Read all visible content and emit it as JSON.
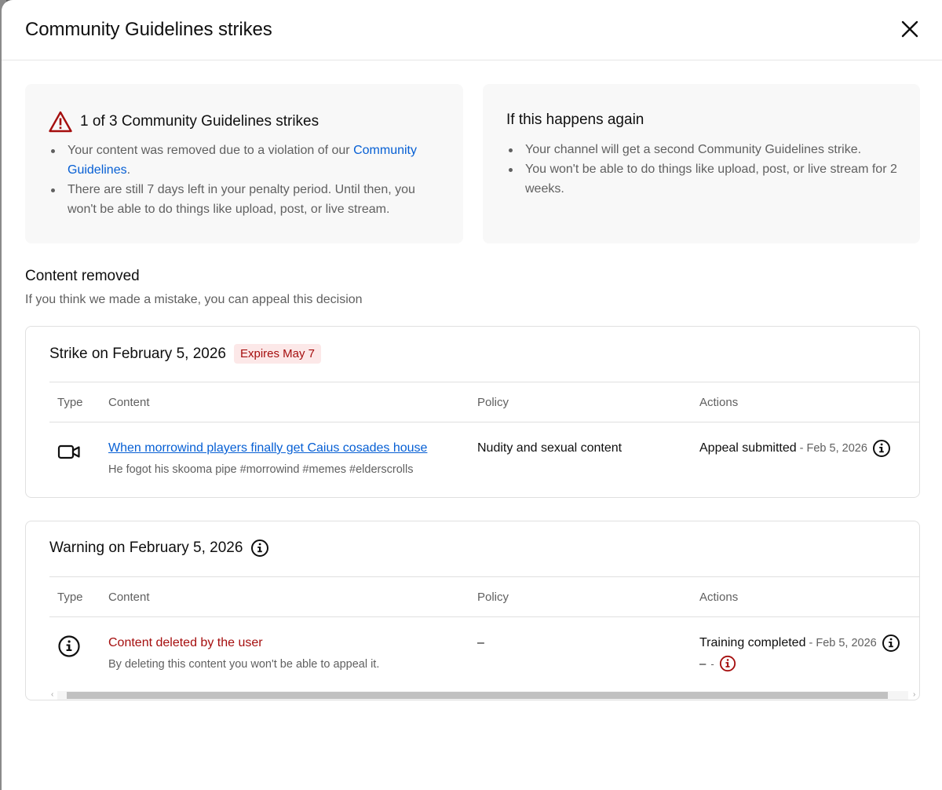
{
  "dialog": {
    "title": "Community Guidelines strikes"
  },
  "strike_summary": {
    "heading": "1 of 3 Community Guidelines strikes",
    "bullet1_text": "Your content was removed due to a violation of our ",
    "bullet1_link": "Community Guidelines",
    "bullet1_end": ".",
    "bullet2": "There are still 7 days left in your penalty period. Until then, you won't be able to do things like upload, post, or live stream."
  },
  "if_again": {
    "heading": "If this happens again",
    "bullets": [
      "Your channel will get a second Community Guidelines strike.",
      "You won't be able to do things like upload, post, or live stream for 2 weeks."
    ]
  },
  "content_removed": {
    "title": "Content removed",
    "subtitle": "If you think we made a mistake, you can appeal this decision"
  },
  "strike_panel": {
    "title": "Strike on February 5, 2026",
    "badge": "Expires May 7",
    "columns": [
      "Type",
      "Content",
      "Policy",
      "Actions"
    ],
    "row": {
      "type_icon": "video-camera-icon",
      "content_title": "When morrowind players finally get Caius cosades house",
      "content_desc": "He fogot his skooma pipe #morrowind #memes #elderscrolls",
      "policy": "Nudity and sexual content",
      "action": "Appeal submitted",
      "action_date": "- Feb 5, 2026"
    }
  },
  "warning_panel": {
    "title": "Warning on February 5, 2026",
    "columns": [
      "Type",
      "Content",
      "Policy",
      "Actions"
    ],
    "row": {
      "type_icon": "info-icon",
      "content_title": "Content deleted by the user",
      "content_desc": "By deleting this content you won't be able to appeal it.",
      "policy": "–",
      "action": "Training completed",
      "action_date": "- Feb 5, 2026",
      "action_sub_dash": "–",
      "action_sub_dash_small": "-"
    }
  },
  "colors": {
    "link": "#065fd4",
    "danger": "#a50e0e",
    "badge_bg": "#fce8e8",
    "card_bg": "#f8f8f8"
  }
}
